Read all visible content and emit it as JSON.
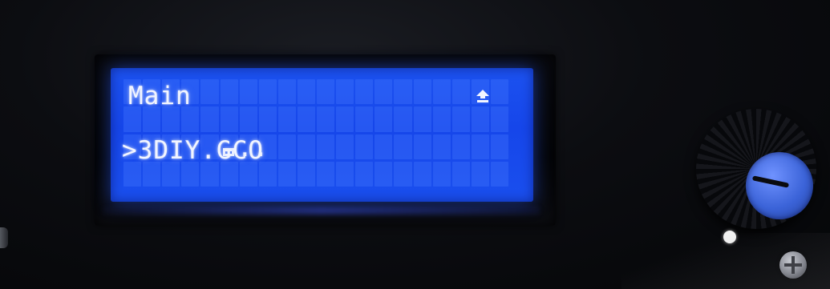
{
  "lcd": {
    "rows": {
      "line1": "Main",
      "line2_suffix": "..",
      "line3": ">3DIY.GCO"
    },
    "icons": {
      "folder": "folder-icon",
      "up_arrow": "up-arrow-icon"
    },
    "colors": {
      "backlight": "#1a4cec",
      "text": "#f2f5ff"
    },
    "grid": {
      "columns": 20,
      "rows": 4
    }
  },
  "hardware": {
    "knob_icon": "rotary-encoder-knob",
    "knob_cap_color": "#3b63d8"
  }
}
